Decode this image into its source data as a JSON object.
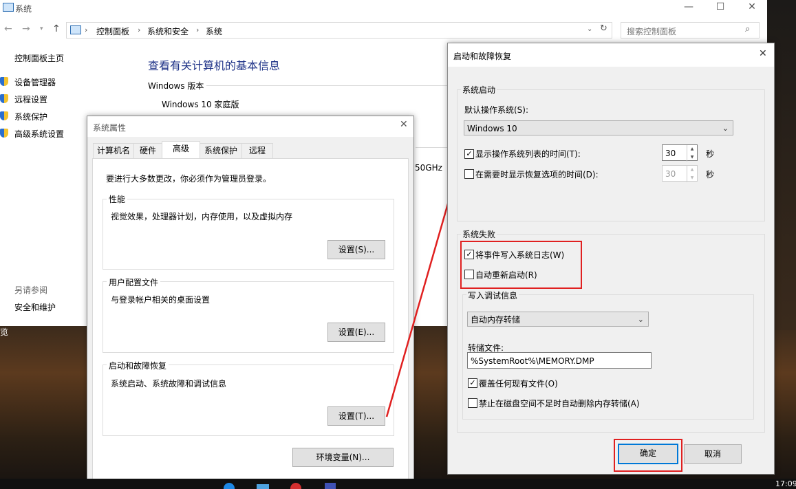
{
  "main_window": {
    "title": "系统",
    "breadcrumb": [
      "控制面板",
      "系统和安全",
      "系统"
    ],
    "search_placeholder": "搜索控制面板",
    "left_nav": {
      "home": "控制面板主页",
      "items": [
        "设备管理器",
        "远程设置",
        "系统保护",
        "高级系统设置"
      ],
      "see_also": "另请参阅",
      "see_also_items": [
        "安全和维护"
      ]
    },
    "heading": "查看有关计算机的基本信息",
    "edition_label": "Windows 版本",
    "edition_value": "Windows 10 家庭版",
    "cpu_partial": "50GHz"
  },
  "desktop_partial_text": "览",
  "sys_props": {
    "title": "系统属性",
    "tabs": [
      "计算机名",
      "硬件",
      "高级",
      "系统保护",
      "远程"
    ],
    "active_tab": "高级",
    "admin_note": "要进行大多数更改，你必须作为管理员登录。",
    "groups": [
      {
        "label": "性能",
        "desc": "视觉效果，处理器计划，内存使用，以及虚拟内存",
        "button": "设置(S)..."
      },
      {
        "label": "用户配置文件",
        "desc": "与登录帐户相关的桌面设置",
        "button": "设置(E)..."
      },
      {
        "label": "启动和故障恢复",
        "desc": "系统启动、系统故障和调试信息",
        "button": "设置(T)..."
      }
    ],
    "env_button": "环境变量(N)..."
  },
  "startup_dlg": {
    "title": "启动和故障恢复",
    "system_startup": {
      "label": "系统启动",
      "default_os_label": "默认操作系统(S):",
      "default_os_value": "Windows 10",
      "show_os_list": {
        "label": "显示操作系统列表的时间(T):",
        "checked": true,
        "value": "30",
        "unit": "秒"
      },
      "show_recovery": {
        "label": "在需要时显示恢复选项的时间(D):",
        "checked": false,
        "value": "30",
        "unit": "秒"
      }
    },
    "system_failure": {
      "label": "系统失败",
      "write_event": {
        "label": "将事件写入系统日志(W)",
        "checked": true
      },
      "auto_restart": {
        "label": "自动重新启动(R)",
        "checked": false
      }
    },
    "debug_info": {
      "label": "写入调试信息",
      "dump_type": "自动内存转储",
      "dump_file_label": "转储文件:",
      "dump_file_value": "%SystemRoot%\\MEMORY.DMP",
      "overwrite": {
        "label": "覆盖任何现有文件(O)",
        "checked": true
      },
      "disable_low_disk": {
        "label": "禁止在磁盘空间不足时自动删除内存转储(A)",
        "checked": false
      }
    },
    "ok_button": "确定",
    "cancel_button": "取消"
  },
  "taskbar_time": "17:09",
  "annotation_color": "#e02020"
}
